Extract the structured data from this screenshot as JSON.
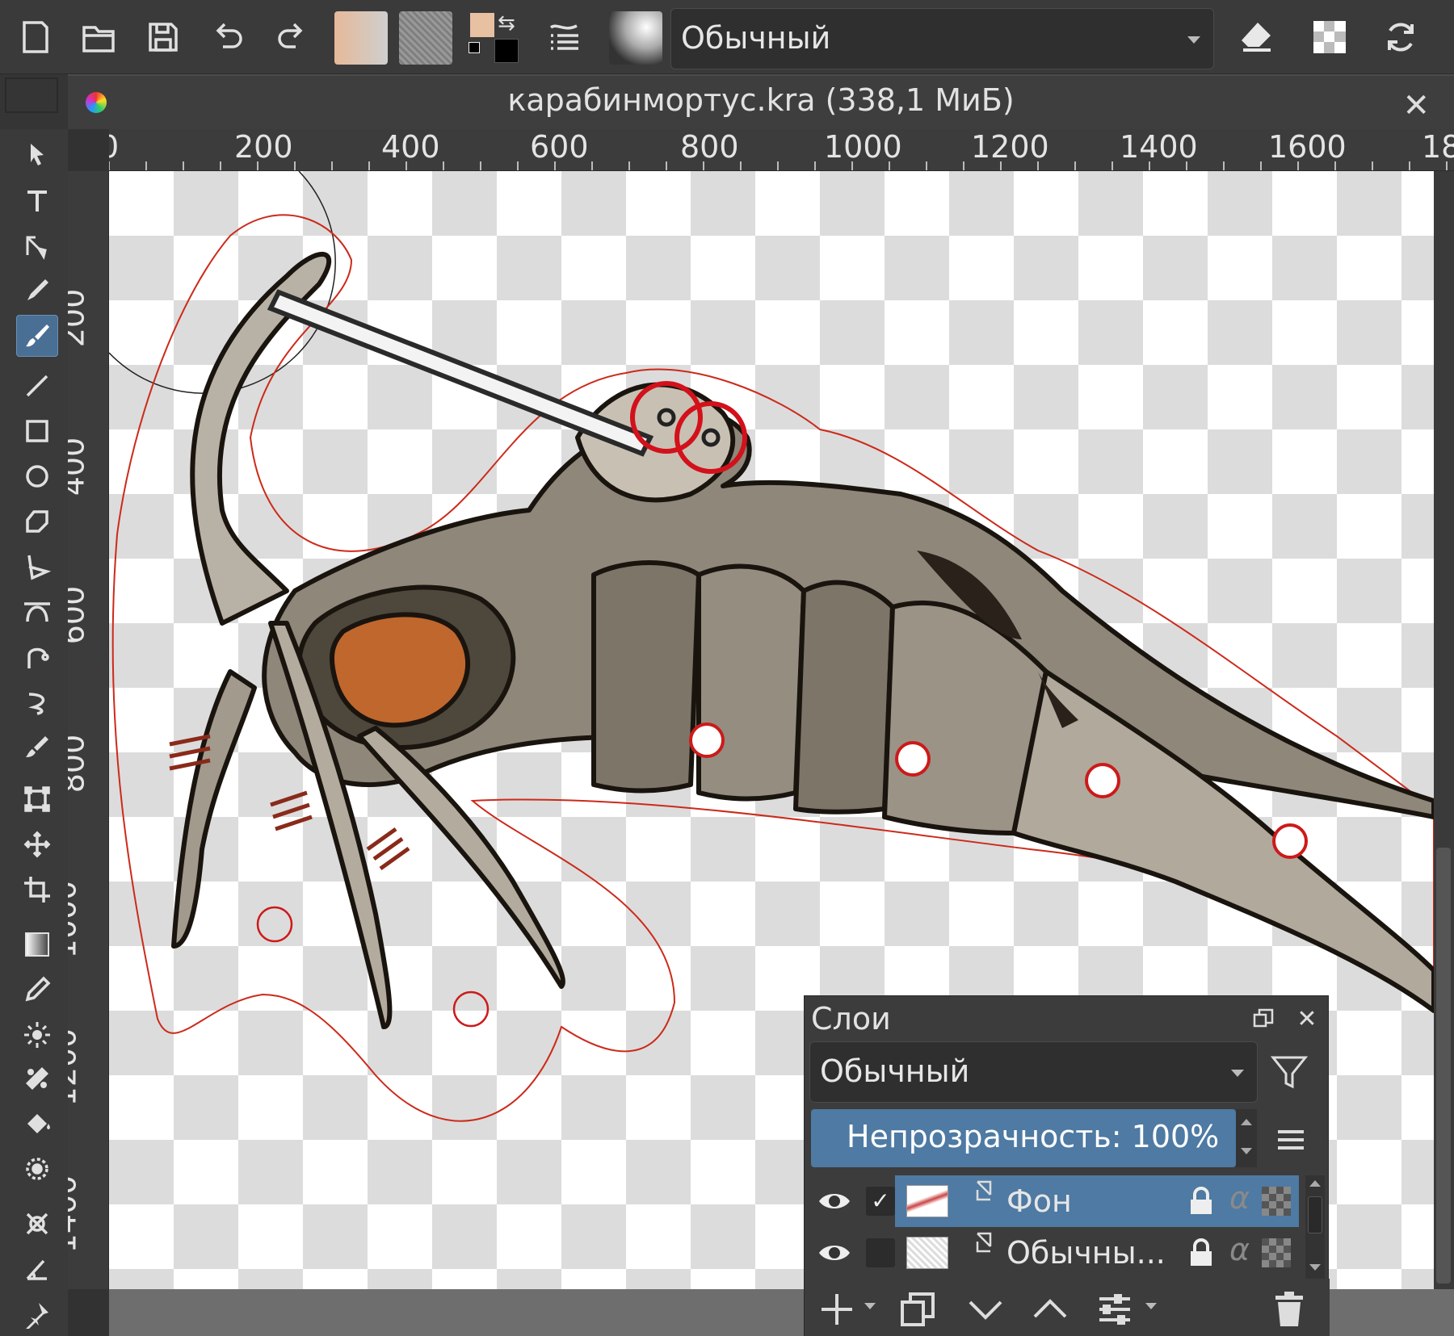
{
  "toolbar": {
    "blend_mode": "Обычный",
    "icons": [
      "new-document-icon",
      "open-folder-icon",
      "save-icon",
      "undo-icon",
      "redo-icon",
      "gradient-swatch",
      "pattern-swatch",
      "color-swap-icon",
      "brush-presets-icon",
      "brush-tip-icon",
      "eraser-icon",
      "alpha-lock-icon",
      "reload-icon"
    ],
    "fg_color": "#e8c0a2",
    "bg_color": "#000000"
  },
  "document": {
    "title": "карабинмортус.kra (338,1 МиБ)"
  },
  "rulers": {
    "horizontal": [
      "0",
      "200",
      "400",
      "600",
      "800",
      "1000",
      "1200",
      "1400",
      "1600",
      "18"
    ],
    "vertical": [
      "200",
      "400",
      "600",
      "800",
      "1000",
      "1200",
      "1400"
    ]
  },
  "toolbox": {
    "tools": [
      "select-shapes",
      "text",
      "edit-shapes",
      "calligraphy",
      "freehand-brush",
      "line",
      "rectangle",
      "ellipse",
      "polygon",
      "polyline",
      "bezier-curve",
      "freehand-path",
      "dynamic-brush",
      "multibrush",
      "transform",
      "move",
      "crop",
      "gradient",
      "color-picker",
      "smart-patch",
      "fill",
      "enclosed-fill",
      "assistant",
      "perspective",
      "measure",
      "reference-images"
    ],
    "active_tool": "freehand-brush"
  },
  "layers_docker": {
    "title": "Слои",
    "blend_mode": "Обычный",
    "opacity_label": "Непрозрачность:",
    "opacity_value": "100%",
    "layers": [
      {
        "name": "Фон",
        "visible": true,
        "selected": true,
        "checked": true,
        "locked": true
      },
      {
        "name": "Обычны...",
        "visible": true,
        "selected": false,
        "checked": false,
        "locked": true
      }
    ],
    "alpha_symbol": "α"
  },
  "colors": {
    "accent": "#4e7aa3",
    "panel": "#3a3a3a",
    "selection_outline": "#cc1a1a"
  }
}
